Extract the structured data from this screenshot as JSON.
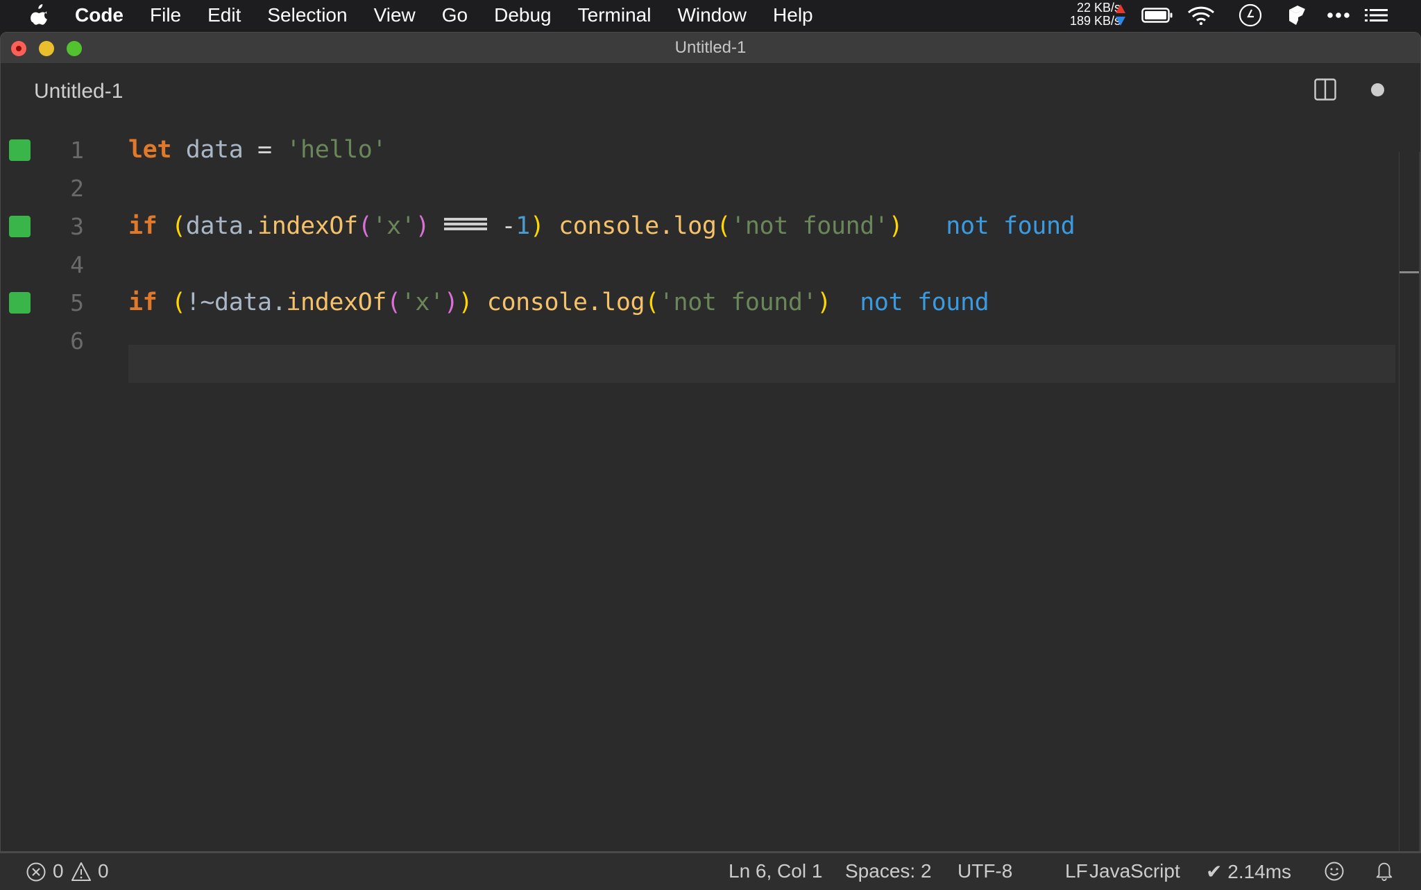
{
  "menubar": {
    "apple_icon": "apple-icon",
    "items": [
      "Code",
      "File",
      "Edit",
      "Selection",
      "View",
      "Go",
      "Debug",
      "Terminal",
      "Window",
      "Help"
    ],
    "network": {
      "upload": "22 KB/s",
      "download": "189 KB/s",
      "upload_color": "#e5392f",
      "download_color": "#2f86e5"
    },
    "status_icons": [
      "battery-icon",
      "wifi-icon",
      "clock-icon",
      "box-icon",
      "more-icon",
      "list-icon"
    ]
  },
  "window": {
    "title": "Untitled-1",
    "controls": [
      "close",
      "minimize",
      "maximize"
    ]
  },
  "tab": {
    "title": "Untitled-1",
    "actions": [
      "split-editor-icon",
      "unsaved-dot-icon"
    ]
  },
  "editor": {
    "gutter_marker_color": "#3ab54a",
    "current_line": 6,
    "lines": [
      {
        "number": "1",
        "marker": true,
        "tokens": [
          {
            "t": "let",
            "c": "kw"
          },
          {
            "t": " ",
            "c": "var"
          },
          {
            "t": "data",
            "c": "var"
          },
          {
            "t": " = ",
            "c": "op"
          },
          {
            "t": "'hello'",
            "c": "str"
          }
        ],
        "result": ""
      },
      {
        "number": "2",
        "marker": false,
        "tokens": [],
        "result": ""
      },
      {
        "number": "3",
        "marker": true,
        "tokens": [
          {
            "t": "if",
            "c": "kw"
          },
          {
            "t": " ",
            "c": "var"
          },
          {
            "t": "(",
            "c": "b1"
          },
          {
            "t": "data",
            "c": "var"
          },
          {
            "t": ".",
            "c": "var"
          },
          {
            "t": "indexOf",
            "c": "fn"
          },
          {
            "t": "(",
            "c": "b2"
          },
          {
            "t": "'x'",
            "c": "str"
          },
          {
            "t": ")",
            "c": "b2"
          },
          {
            "t": " ",
            "c": "var"
          },
          {
            "t": "===",
            "c": "triple"
          },
          {
            "t": " -",
            "c": "op"
          },
          {
            "t": "1",
            "c": "num"
          },
          {
            "t": ")",
            "c": "b1"
          },
          {
            "t": " ",
            "c": "var"
          },
          {
            "t": "console.log",
            "c": "fn"
          },
          {
            "t": "(",
            "c": "b1"
          },
          {
            "t": "'not found'",
            "c": "str"
          },
          {
            "t": ")",
            "c": "b1"
          }
        ],
        "result": "not found"
      },
      {
        "number": "4",
        "marker": false,
        "tokens": [],
        "result": ""
      },
      {
        "number": "5",
        "marker": true,
        "tokens": [
          {
            "t": "if",
            "c": "kw"
          },
          {
            "t": " ",
            "c": "var"
          },
          {
            "t": "(",
            "c": "b1"
          },
          {
            "t": "!~",
            "c": "var"
          },
          {
            "t": "data",
            "c": "var"
          },
          {
            "t": ".",
            "c": "var"
          },
          {
            "t": "indexOf",
            "c": "fn"
          },
          {
            "t": "(",
            "c": "b2"
          },
          {
            "t": "'x'",
            "c": "str"
          },
          {
            "t": ")",
            "c": "b2"
          },
          {
            "t": ")",
            "c": "b1"
          },
          {
            "t": " ",
            "c": "var"
          },
          {
            "t": "console.log",
            "c": "fn"
          },
          {
            "t": "(",
            "c": "b1"
          },
          {
            "t": "'not found'",
            "c": "str"
          },
          {
            "t": ")",
            "c": "b1"
          }
        ],
        "result": "not found"
      },
      {
        "number": "6",
        "marker": false,
        "tokens": [],
        "result": ""
      }
    ]
  },
  "statusbar": {
    "errors": "0",
    "warnings": "0",
    "position": "Ln 6, Col 1",
    "indent": "Spaces: 2",
    "encoding": "UTF-8",
    "eol": "LF",
    "language": "JavaScript",
    "timing": "✔ 2.14ms",
    "right_icons": [
      "feedback-smiley-icon",
      "notifications-bell-icon"
    ]
  }
}
